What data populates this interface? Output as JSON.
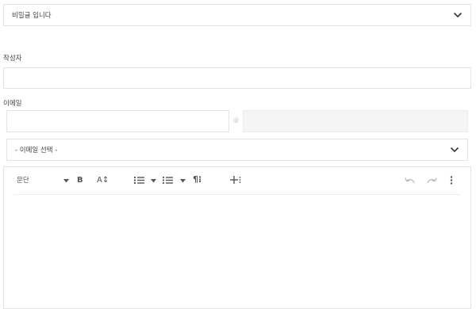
{
  "secret_select": {
    "value": "비밀글 입니다"
  },
  "author": {
    "label": "작성자",
    "value": ""
  },
  "email": {
    "label": "이메일",
    "local_value": "",
    "at_symbol": "@",
    "domain_value": "",
    "domain_select_value": "- 이메일 선택 -"
  },
  "editor": {
    "toolbar": {
      "paragraph_label": "문단",
      "bold_label": "B",
      "font_size_label": "A↕"
    },
    "content": ""
  },
  "colors": {
    "border": "#e3e3e3",
    "text": "#333333",
    "muted": "#bbbbbb",
    "icon": "#555555"
  }
}
